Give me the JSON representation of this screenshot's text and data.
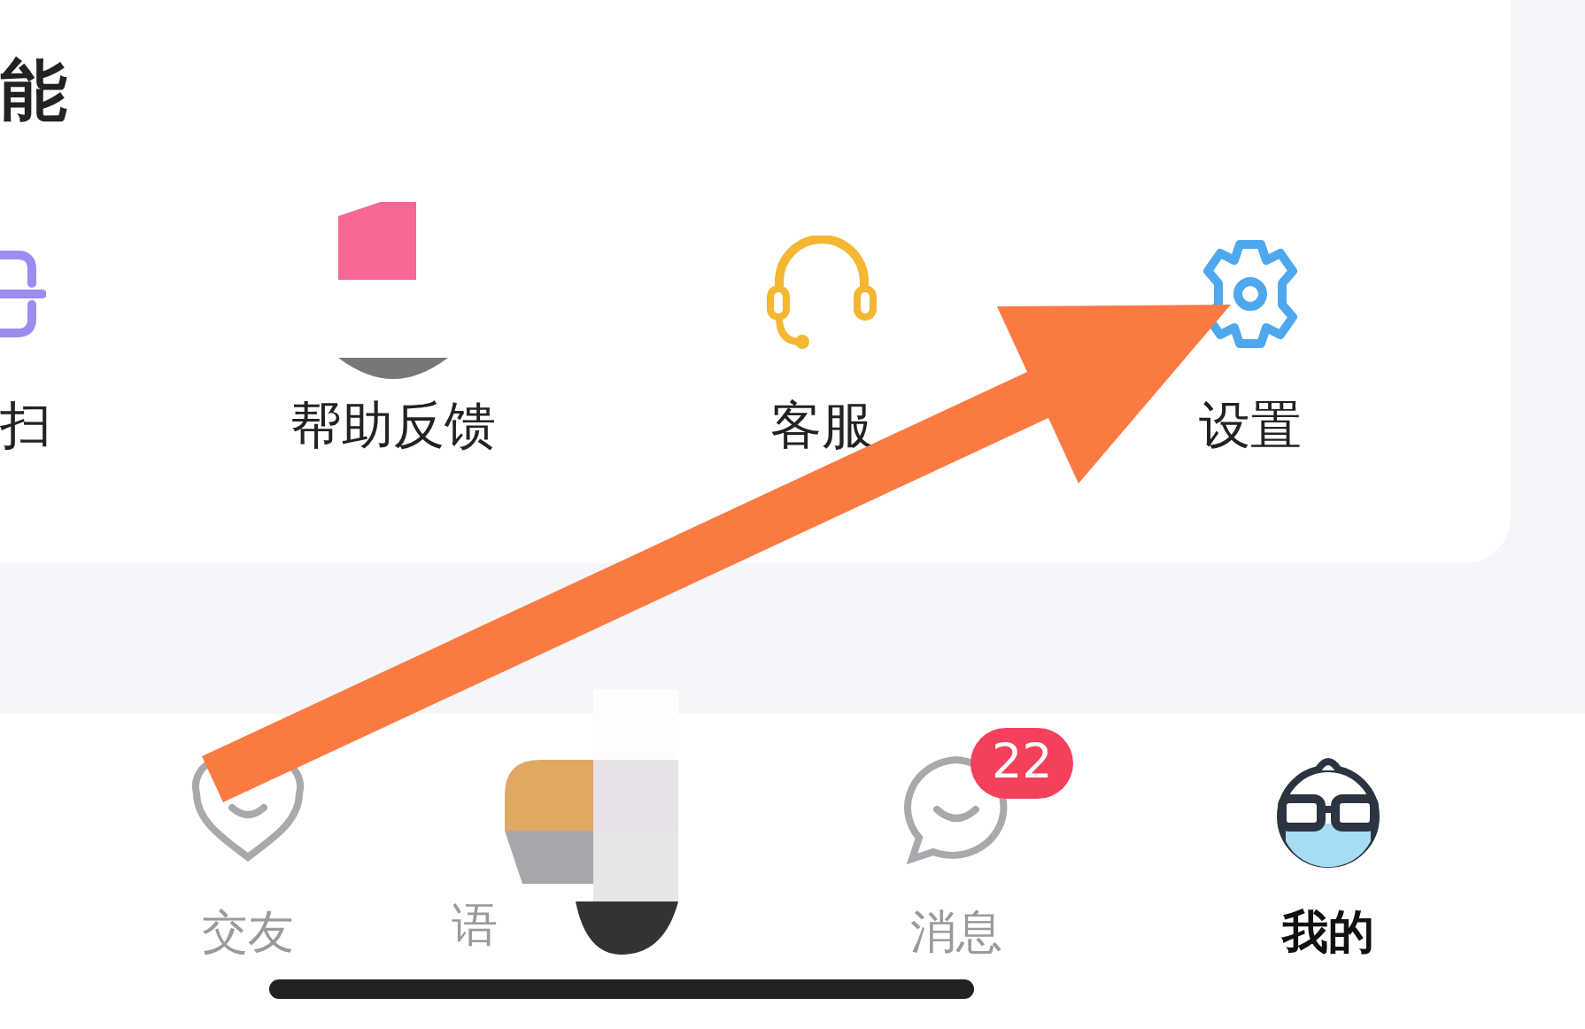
{
  "section": {
    "title": "能",
    "items": [
      {
        "kind": "scan",
        "label": "扫"
      },
      {
        "kind": "feedback",
        "label": "帮助反馈"
      },
      {
        "kind": "service",
        "label": "客服"
      },
      {
        "kind": "settings",
        "label": "设置"
      }
    ]
  },
  "tab_bar": [
    {
      "kind": "friends",
      "label": "交友",
      "selected": false
    },
    {
      "kind": "voice",
      "label": "语",
      "selected": false
    },
    {
      "kind": "messages",
      "label": "消息",
      "badge": "22",
      "selected": false
    },
    {
      "kind": "me",
      "label": "我的",
      "selected": true
    }
  ]
}
